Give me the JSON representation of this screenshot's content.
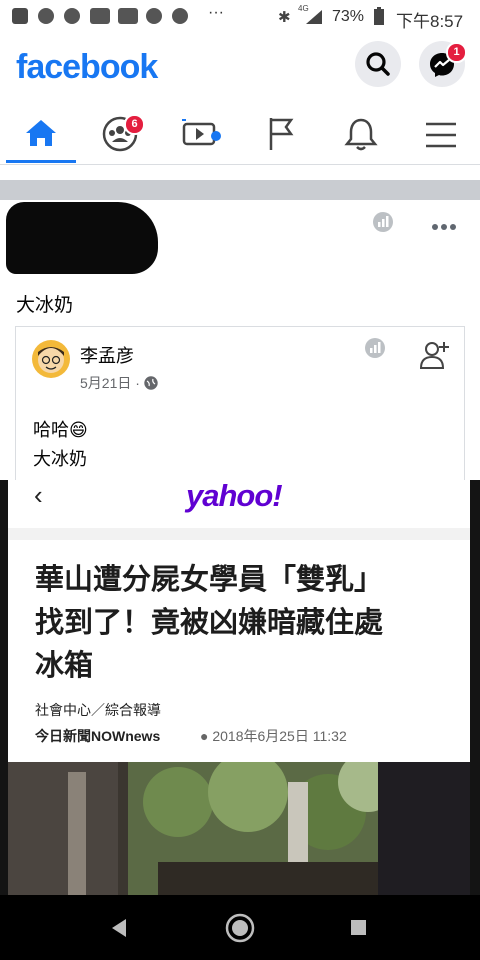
{
  "status_bar": {
    "battery": "73%",
    "time": "下午8:57",
    "network": "4G",
    "dots": "···"
  },
  "header": {
    "logo": "facebook",
    "messenger_badge": "1"
  },
  "tabs": [
    {
      "name": "home",
      "active": true
    },
    {
      "name": "groups",
      "badge": "6"
    },
    {
      "name": "watch"
    },
    {
      "name": "pages"
    },
    {
      "name": "notifications"
    },
    {
      "name": "menu"
    }
  ],
  "post": {
    "text": "大冰奶",
    "shared": {
      "author": "李孟彦",
      "date": "5月21日 · ",
      "line1": "哈哈😄",
      "line2": "大冰奶"
    }
  },
  "embed": {
    "logo": "yahoo!",
    "back": "‹",
    "headline_lines": [
      "華山遭分屍女學員「雙乳」",
      "找到了！竟被凶嫌暗藏住處",
      "冰箱"
    ],
    "byline": "社會中心／綜合報導",
    "source": "今日新聞NOWnews",
    "datetime": "● 2018年6月25日 11:32"
  },
  "colors": {
    "facebook_blue": "#1877f2",
    "yahoo_purple": "#6001d2",
    "badge_red": "#e41e3f"
  }
}
